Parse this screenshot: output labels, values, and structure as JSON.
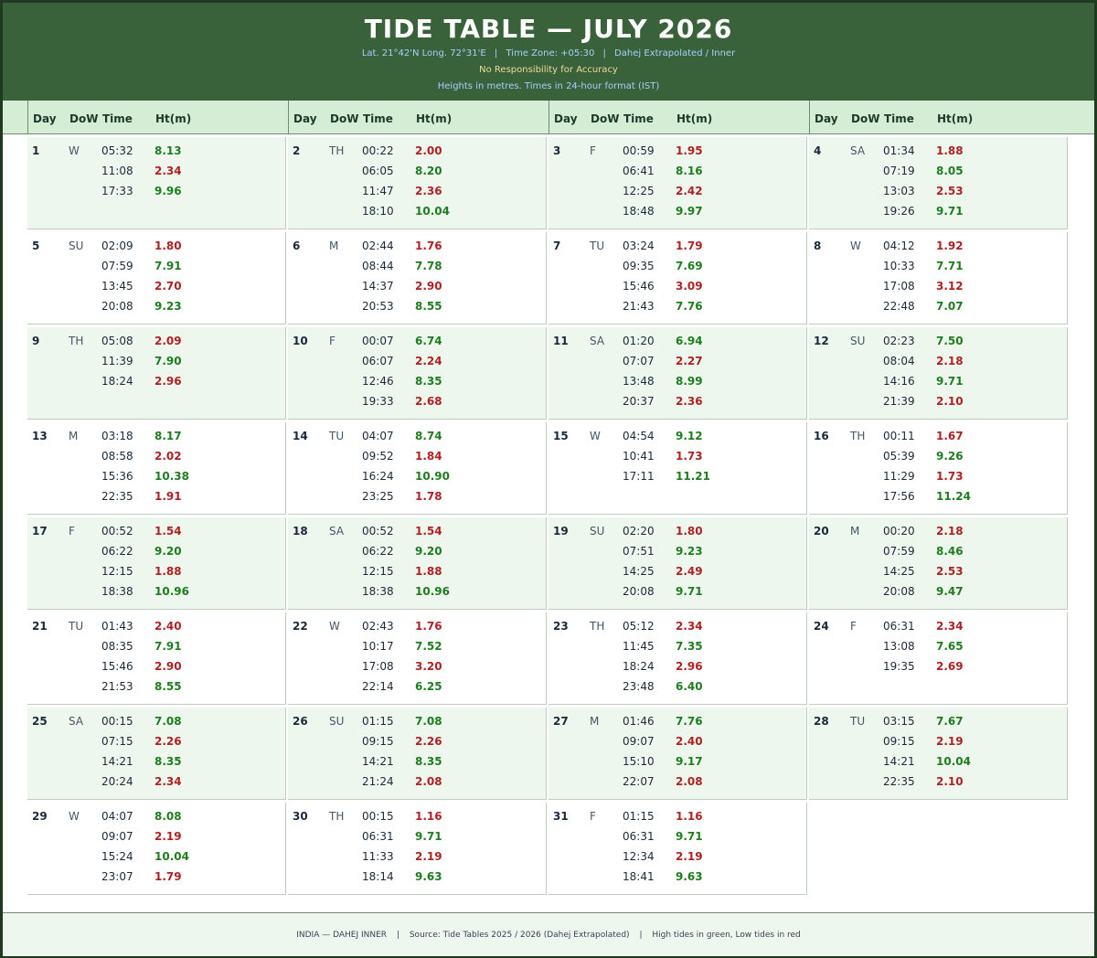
{
  "header": {
    "title": "TIDE TABLE — JULY 2026",
    "lat_long": "Lat. 21°42'N  Long. 72°31'E",
    "time_zone": "Time Zone: +05:30",
    "station": "Dahej Extrapolated / Inner",
    "separator": "|",
    "disclaimer": "No Responsibility for Accuracy",
    "units_note": "Heights in metres.  Times in 24-hour format (IST)"
  },
  "columns": {
    "day": "Day",
    "dow": "DoW",
    "time": "Time",
    "height": "Ht(m)"
  },
  "colors": {
    "high_tide": "#1e7d1e",
    "low_tide": "#b02222",
    "header_bg": "#39623a"
  },
  "days": [
    {
      "day": "1",
      "dow": "W",
      "tides": [
        {
          "time": "05:32",
          "ht": "8.13",
          "type": "high"
        },
        {
          "time": "11:08",
          "ht": "2.34",
          "type": "low"
        },
        {
          "time": "17:33",
          "ht": "9.96",
          "type": "high"
        }
      ]
    },
    {
      "day": "2",
      "dow": "TH",
      "tides": [
        {
          "time": "00:22",
          "ht": "2.00",
          "type": "low"
        },
        {
          "time": "06:05",
          "ht": "8.20",
          "type": "high"
        },
        {
          "time": "11:47",
          "ht": "2.36",
          "type": "low"
        },
        {
          "time": "18:10",
          "ht": "10.04",
          "type": "high"
        }
      ]
    },
    {
      "day": "3",
      "dow": "F",
      "tides": [
        {
          "time": "00:59",
          "ht": "1.95",
          "type": "low"
        },
        {
          "time": "06:41",
          "ht": "8.16",
          "type": "high"
        },
        {
          "time": "12:25",
          "ht": "2.42",
          "type": "low"
        },
        {
          "time": "18:48",
          "ht": "9.97",
          "type": "high"
        }
      ]
    },
    {
      "day": "4",
      "dow": "SA",
      "tides": [
        {
          "time": "01:34",
          "ht": "1.88",
          "type": "low"
        },
        {
          "time": "07:19",
          "ht": "8.05",
          "type": "high"
        },
        {
          "time": "13:03",
          "ht": "2.53",
          "type": "low"
        },
        {
          "time": "19:26",
          "ht": "9.71",
          "type": "high"
        }
      ]
    },
    {
      "day": "5",
      "dow": "SU",
      "tides": [
        {
          "time": "02:09",
          "ht": "1.80",
          "type": "low"
        },
        {
          "time": "07:59",
          "ht": "7.91",
          "type": "high"
        },
        {
          "time": "13:45",
          "ht": "2.70",
          "type": "low"
        },
        {
          "time": "20:08",
          "ht": "9.23",
          "type": "high"
        }
      ]
    },
    {
      "day": "6",
      "dow": "M",
      "tides": [
        {
          "time": "02:44",
          "ht": "1.76",
          "type": "low"
        },
        {
          "time": "08:44",
          "ht": "7.78",
          "type": "high"
        },
        {
          "time": "14:37",
          "ht": "2.90",
          "type": "low"
        },
        {
          "time": "20:53",
          "ht": "8.55",
          "type": "high"
        }
      ]
    },
    {
      "day": "7",
      "dow": "TU",
      "tides": [
        {
          "time": "03:24",
          "ht": "1.79",
          "type": "low"
        },
        {
          "time": "09:35",
          "ht": "7.69",
          "type": "high"
        },
        {
          "time": "15:46",
          "ht": "3.09",
          "type": "low"
        },
        {
          "time": "21:43",
          "ht": "7.76",
          "type": "high"
        }
      ]
    },
    {
      "day": "8",
      "dow": "W",
      "tides": [
        {
          "time": "04:12",
          "ht": "1.92",
          "type": "low"
        },
        {
          "time": "10:33",
          "ht": "7.71",
          "type": "high"
        },
        {
          "time": "17:08",
          "ht": "3.12",
          "type": "low"
        },
        {
          "time": "22:48",
          "ht": "7.07",
          "type": "high"
        }
      ]
    },
    {
      "day": "9",
      "dow": "TH",
      "tides": [
        {
          "time": "05:08",
          "ht": "2.09",
          "type": "low"
        },
        {
          "time": "11:39",
          "ht": "7.90",
          "type": "high"
        },
        {
          "time": "18:24",
          "ht": "2.96",
          "type": "low"
        }
      ]
    },
    {
      "day": "10",
      "dow": "F",
      "tides": [
        {
          "time": "00:07",
          "ht": "6.74",
          "type": "high"
        },
        {
          "time": "06:07",
          "ht": "2.24",
          "type": "low"
        },
        {
          "time": "12:46",
          "ht": "8.35",
          "type": "high"
        },
        {
          "time": "19:33",
          "ht": "2.68",
          "type": "low"
        }
      ]
    },
    {
      "day": "11",
      "dow": "SA",
      "tides": [
        {
          "time": "01:20",
          "ht": "6.94",
          "type": "high"
        },
        {
          "time": "07:07",
          "ht": "2.27",
          "type": "low"
        },
        {
          "time": "13:48",
          "ht": "8.99",
          "type": "high"
        },
        {
          "time": "20:37",
          "ht": "2.36",
          "type": "low"
        }
      ]
    },
    {
      "day": "12",
      "dow": "SU",
      "tides": [
        {
          "time": "02:23",
          "ht": "7.50",
          "type": "high"
        },
        {
          "time": "08:04",
          "ht": "2.18",
          "type": "low"
        },
        {
          "time": "14:16",
          "ht": "9.71",
          "type": "high"
        },
        {
          "time": "21:39",
          "ht": "2.10",
          "type": "low"
        }
      ]
    },
    {
      "day": "13",
      "dow": "M",
      "tides": [
        {
          "time": "03:18",
          "ht": "8.17",
          "type": "high"
        },
        {
          "time": "08:58",
          "ht": "2.02",
          "type": "low"
        },
        {
          "time": "15:36",
          "ht": "10.38",
          "type": "high"
        },
        {
          "time": "22:35",
          "ht": "1.91",
          "type": "low"
        }
      ]
    },
    {
      "day": "14",
      "dow": "TU",
      "tides": [
        {
          "time": "04:07",
          "ht": "8.74",
          "type": "high"
        },
        {
          "time": "09:52",
          "ht": "1.84",
          "type": "low"
        },
        {
          "time": "16:24",
          "ht": "10.90",
          "type": "high"
        },
        {
          "time": "23:25",
          "ht": "1.78",
          "type": "low"
        }
      ]
    },
    {
      "day": "15",
      "dow": "W",
      "tides": [
        {
          "time": "04:54",
          "ht": "9.12",
          "type": "high"
        },
        {
          "time": "10:41",
          "ht": "1.73",
          "type": "low"
        },
        {
          "time": "17:11",
          "ht": "11.21",
          "type": "high"
        }
      ]
    },
    {
      "day": "16",
      "dow": "TH",
      "tides": [
        {
          "time": "00:11",
          "ht": "1.67",
          "type": "low"
        },
        {
          "time": "05:39",
          "ht": "9.26",
          "type": "high"
        },
        {
          "time": "11:29",
          "ht": "1.73",
          "type": "low"
        },
        {
          "time": "17:56",
          "ht": "11.24",
          "type": "high"
        }
      ]
    },
    {
      "day": "17",
      "dow": "F",
      "tides": [
        {
          "time": "00:52",
          "ht": "1.54",
          "type": "low"
        },
        {
          "time": "06:22",
          "ht": "9.20",
          "type": "high"
        },
        {
          "time": "12:15",
          "ht": "1.88",
          "type": "low"
        },
        {
          "time": "18:38",
          "ht": "10.96",
          "type": "high"
        }
      ]
    },
    {
      "day": "18",
      "dow": "SA",
      "tides": [
        {
          "time": "00:52",
          "ht": "1.54",
          "type": "low"
        },
        {
          "time": "06:22",
          "ht": "9.20",
          "type": "high"
        },
        {
          "time": "12:15",
          "ht": "1.88",
          "type": "low"
        },
        {
          "time": "18:38",
          "ht": "10.96",
          "type": "high"
        }
      ]
    },
    {
      "day": "19",
      "dow": "SU",
      "tides": [
        {
          "time": "02:20",
          "ht": "1.80",
          "type": "low"
        },
        {
          "time": "07:51",
          "ht": "9.23",
          "type": "high"
        },
        {
          "time": "14:25",
          "ht": "2.49",
          "type": "low"
        },
        {
          "time": "20:08",
          "ht": "9.71",
          "type": "high"
        }
      ]
    },
    {
      "day": "20",
      "dow": "M",
      "tides": [
        {
          "time": "00:20",
          "ht": "2.18",
          "type": "low"
        },
        {
          "time": "07:59",
          "ht": "8.46",
          "type": "high"
        },
        {
          "time": "14:25",
          "ht": "2.53",
          "type": "low"
        },
        {
          "time": "20:08",
          "ht": "9.47",
          "type": "high"
        }
      ]
    },
    {
      "day": "21",
      "dow": "TU",
      "tides": [
        {
          "time": "01:43",
          "ht": "2.40",
          "type": "low"
        },
        {
          "time": "08:35",
          "ht": "7.91",
          "type": "high"
        },
        {
          "time": "15:46",
          "ht": "2.90",
          "type": "low"
        },
        {
          "time": "21:53",
          "ht": "8.55",
          "type": "high"
        }
      ]
    },
    {
      "day": "22",
      "dow": "W",
      "tides": [
        {
          "time": "02:43",
          "ht": "1.76",
          "type": "low"
        },
        {
          "time": "10:17",
          "ht": "7.52",
          "type": "high"
        },
        {
          "time": "17:08",
          "ht": "3.20",
          "type": "low"
        },
        {
          "time": "22:14",
          "ht": "6.25",
          "type": "high"
        }
      ]
    },
    {
      "day": "23",
      "dow": "TH",
      "tides": [
        {
          "time": "05:12",
          "ht": "2.34",
          "type": "low"
        },
        {
          "time": "11:45",
          "ht": "7.35",
          "type": "high"
        },
        {
          "time": "18:24",
          "ht": "2.96",
          "type": "low"
        },
        {
          "time": "23:48",
          "ht": "6.40",
          "type": "high"
        }
      ]
    },
    {
      "day": "24",
      "dow": "F",
      "tides": [
        {
          "time": "06:31",
          "ht": "2.34",
          "type": "low"
        },
        {
          "time": "13:08",
          "ht": "7.65",
          "type": "high"
        },
        {
          "time": "19:35",
          "ht": "2.69",
          "type": "low"
        }
      ]
    },
    {
      "day": "25",
      "dow": "SA",
      "tides": [
        {
          "time": "00:15",
          "ht": "7.08",
          "type": "high"
        },
        {
          "time": "07:15",
          "ht": "2.26",
          "type": "low"
        },
        {
          "time": "14:21",
          "ht": "8.35",
          "type": "high"
        },
        {
          "time": "20:24",
          "ht": "2.34",
          "type": "low"
        }
      ]
    },
    {
      "day": "26",
      "dow": "SU",
      "tides": [
        {
          "time": "01:15",
          "ht": "7.08",
          "type": "high"
        },
        {
          "time": "09:15",
          "ht": "2.26",
          "type": "low"
        },
        {
          "time": "14:21",
          "ht": "8.35",
          "type": "high"
        },
        {
          "time": "21:24",
          "ht": "2.08",
          "type": "low"
        }
      ]
    },
    {
      "day": "27",
      "dow": "M",
      "tides": [
        {
          "time": "01:46",
          "ht": "7.76",
          "type": "high"
        },
        {
          "time": "09:07",
          "ht": "2.40",
          "type": "low"
        },
        {
          "time": "15:10",
          "ht": "9.17",
          "type": "high"
        },
        {
          "time": "22:07",
          "ht": "2.08",
          "type": "low"
        }
      ]
    },
    {
      "day": "28",
      "dow": "TU",
      "tides": [
        {
          "time": "03:15",
          "ht": "7.67",
          "type": "high"
        },
        {
          "time": "09:15",
          "ht": "2.19",
          "type": "low"
        },
        {
          "time": "14:21",
          "ht": "10.04",
          "type": "high"
        },
        {
          "time": "22:35",
          "ht": "2.10",
          "type": "low"
        }
      ]
    },
    {
      "day": "29",
      "dow": "W",
      "tides": [
        {
          "time": "04:07",
          "ht": "8.08",
          "type": "high"
        },
        {
          "time": "09:07",
          "ht": "2.19",
          "type": "low"
        },
        {
          "time": "15:24",
          "ht": "10.04",
          "type": "high"
        },
        {
          "time": "23:07",
          "ht": "1.79",
          "type": "low"
        }
      ]
    },
    {
      "day": "30",
      "dow": "TH",
      "tides": [
        {
          "time": "00:15",
          "ht": "1.16",
          "type": "low"
        },
        {
          "time": "06:31",
          "ht": "9.71",
          "type": "high"
        },
        {
          "time": "11:33",
          "ht": "2.19",
          "type": "low"
        },
        {
          "time": "18:14",
          "ht": "9.63",
          "type": "high"
        }
      ]
    },
    {
      "day": "31",
      "dow": "F",
      "tides": [
        {
          "time": "01:15",
          "ht": "1.16",
          "type": "low"
        },
        {
          "time": "06:31",
          "ht": "9.71",
          "type": "high"
        },
        {
          "time": "12:34",
          "ht": "2.19",
          "type": "low"
        },
        {
          "time": "18:41",
          "ht": "9.63",
          "type": "high"
        }
      ]
    }
  ],
  "footer": {
    "location": "INDIA — DAHEJ INNER",
    "source": "Source: Tide Tables 2025 / 2026 (Dahej Extrapolated)",
    "legend": "High tides in green, Low tides in red",
    "separator": "|"
  }
}
